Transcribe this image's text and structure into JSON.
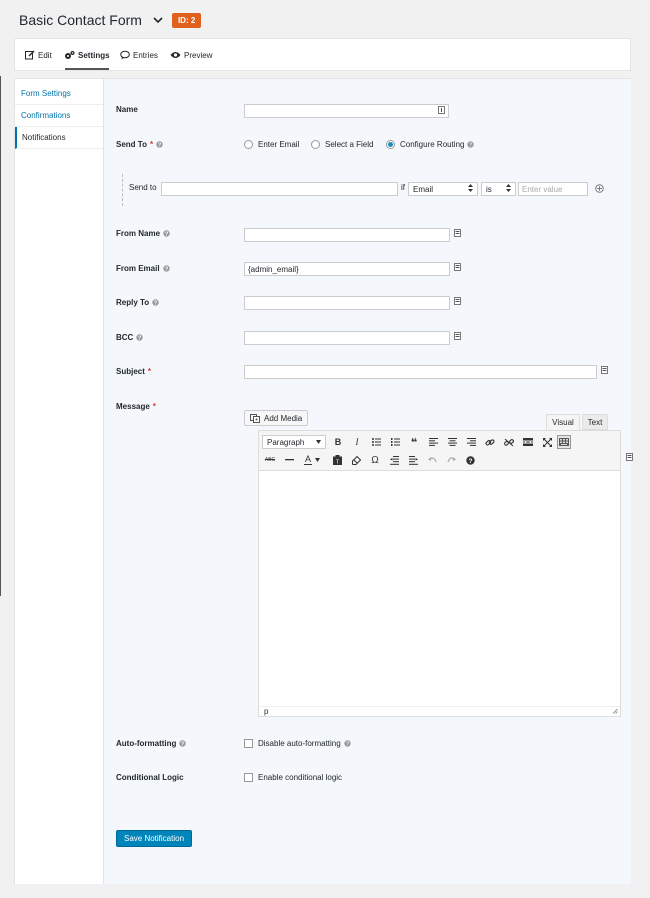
{
  "header": {
    "form_title": "Basic Contact Form",
    "id_badge": "ID: 2"
  },
  "toolbar": {
    "edit": "Edit",
    "settings": "Settings",
    "entries": "Entries",
    "preview": "Preview"
  },
  "sidebar": {
    "items": [
      {
        "label": "Form Settings"
      },
      {
        "label": "Confirmations"
      },
      {
        "label": "Notifications"
      }
    ]
  },
  "form": {
    "name_label": "Name",
    "send_to_label": "Send To",
    "send_to_options": [
      "Enter Email",
      "Select a Field",
      "Configure Routing"
    ],
    "routing": {
      "send_to_label": "Send to",
      "if_label": "if",
      "field_value": "Email",
      "operator_value": "is",
      "value_placeholder": "Enter value"
    },
    "from_name_label": "From Name",
    "from_email_label": "From Email",
    "from_email_value": "{admin_email}",
    "reply_to_label": "Reply To",
    "bcc_label": "BCC",
    "subject_label": "Subject",
    "message_label": "Message",
    "add_media": "Add Media",
    "tab_visual": "Visual",
    "tab_text": "Text",
    "paragraph_select": "Paragraph",
    "editor_path": "p",
    "autoformat_label": "Auto-formatting",
    "autoformat_checkbox": "Disable auto-formatting",
    "conditional_label": "Conditional Logic",
    "conditional_checkbox": "Enable conditional logic",
    "save_button": "Save Notification",
    "required_mark": "*"
  },
  "colors": {
    "accent": "#0073aa",
    "badge": "#e0611d",
    "primary_button": "#0085ba",
    "required": "#d63638"
  }
}
